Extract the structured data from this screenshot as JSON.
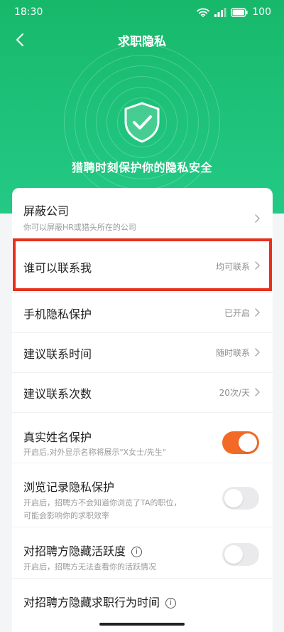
{
  "status_bar": {
    "time": "18:30",
    "battery": "100"
  },
  "nav": {
    "title": "求职隐私"
  },
  "hero": {
    "slogan": "猎聘时刻保护你的隐私安全"
  },
  "colors": {
    "brand_green": "#1ec27a",
    "toggle_on": "#f36a26",
    "highlight": "#e8301c"
  },
  "rows": {
    "block_company": {
      "title": "屏蔽公司",
      "desc": "你可以屏蔽HR或猎头所在的公司"
    },
    "who_contact": {
      "title": "谁可以联系我",
      "value": "均可联系"
    },
    "phone_privacy": {
      "title": "手机隐私保护",
      "value": "已开启"
    },
    "contact_time": {
      "title": "建议联系时间",
      "value": "随时联系"
    },
    "contact_count": {
      "title": "建议联系次数",
      "value": "20次/天"
    },
    "real_name": {
      "title": "真实姓名保护",
      "desc": "开启后,对外显示名称将展示\"X女士/先生\"",
      "enabled": true
    },
    "browse_privacy": {
      "title": "浏览记录隐私保护",
      "desc_line1": "开启后，招聘方不会知道你浏览了TA的职位，",
      "desc_line2": "可能会影响你的求职效率",
      "enabled": false
    },
    "hide_activity": {
      "title": "对招聘方隐藏活跃度",
      "desc": "开启后，招聘方无法查看你的活跃情况",
      "enabled": false
    },
    "hide_job_time": {
      "title": "对招聘方隐藏求职行为时间"
    }
  }
}
